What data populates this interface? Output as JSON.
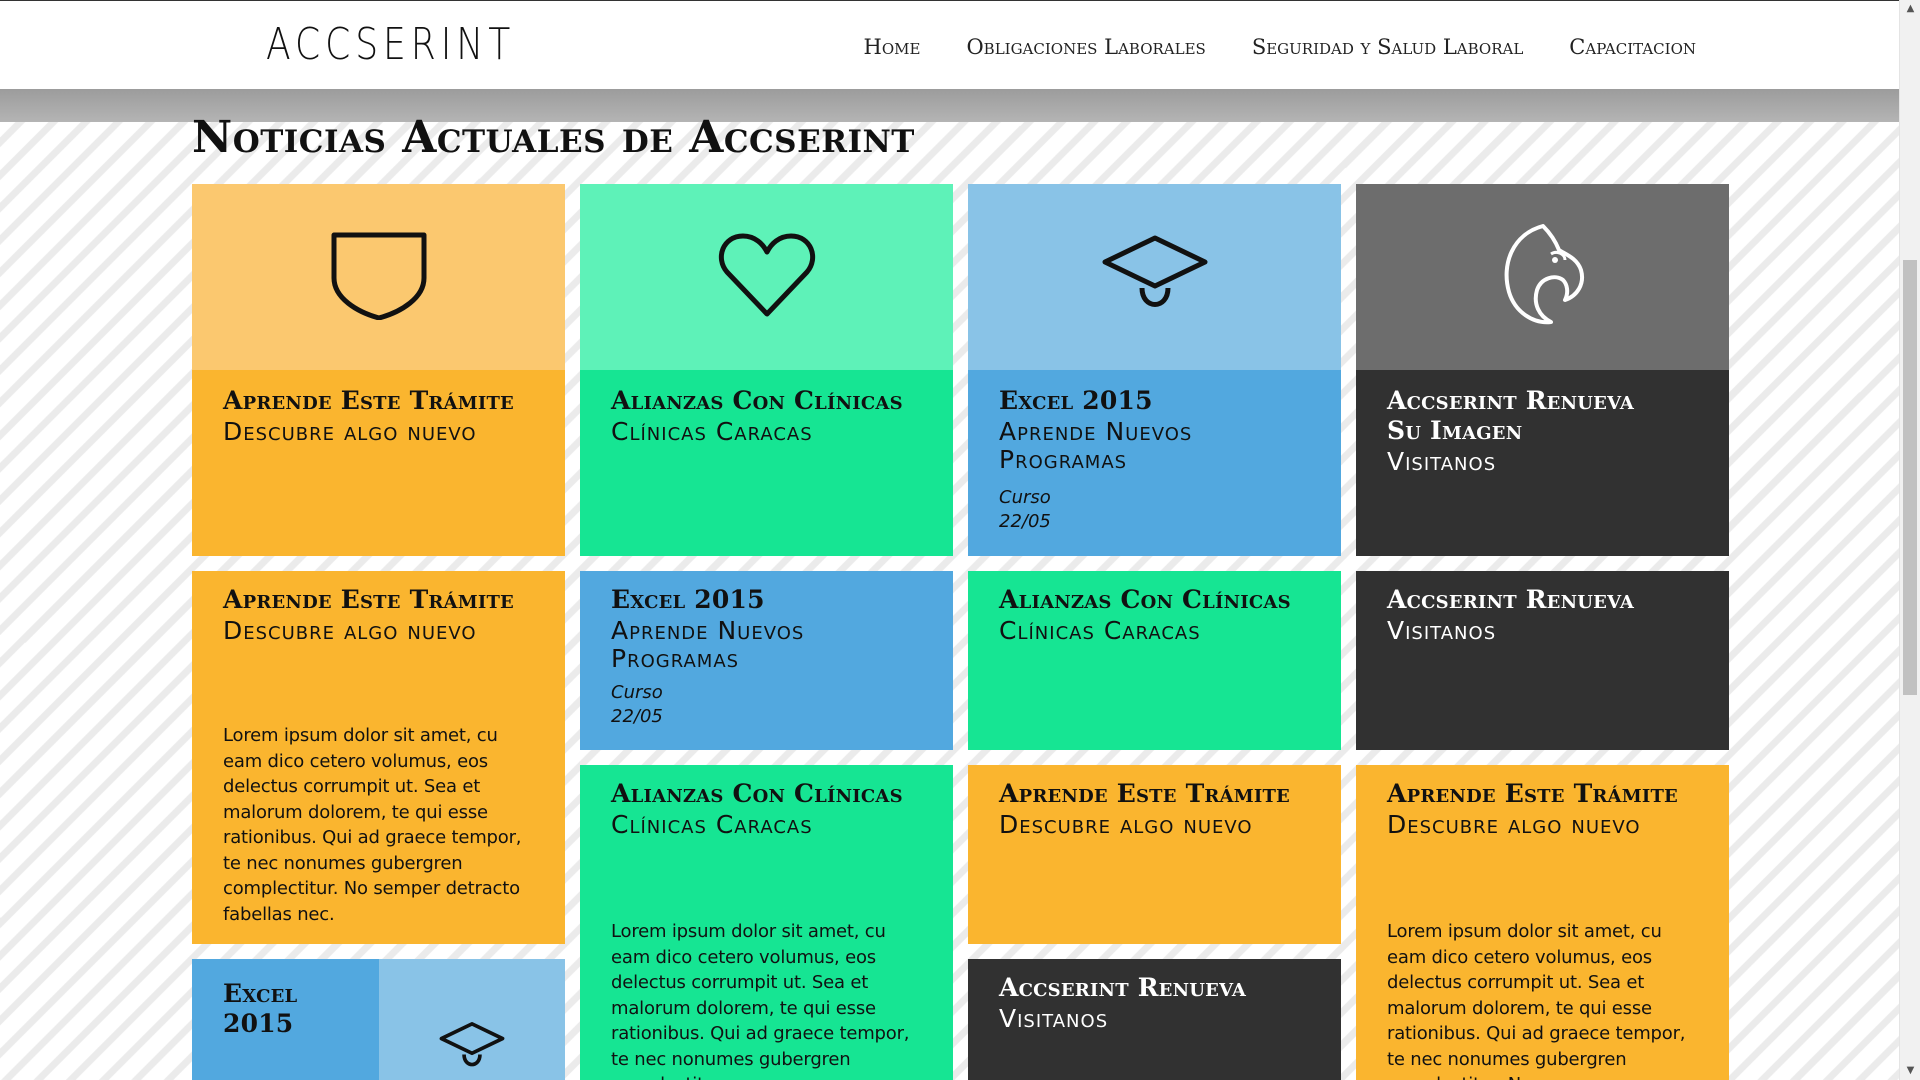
{
  "header": {
    "logo": "ACCSERINT",
    "nav": [
      "Home",
      "Obligaciones Laborales",
      "Seguridad y Salud Laboral",
      "Capacitacion"
    ]
  },
  "main": {
    "title": "Noticias Actuales de Accserint"
  },
  "colors": {
    "orange": "#fab52f",
    "orange_light": "#fbc86f",
    "green": "#16e593",
    "green_light": "#5ef2b8",
    "blue": "#52a8df",
    "blue_light": "#89c3e7",
    "dark": "#313131",
    "gray": "#6d6d6d"
  },
  "tiles": [
    {
      "title": "Aprende Este Trámite",
      "subtitle": "Descubre algo nuevo",
      "icon": "shield-icon"
    },
    {
      "title": "Alianzas Con Clínicas",
      "subtitle": "Clínicas Caracas",
      "icon": "heart-icon"
    },
    {
      "title": "Excel 2015",
      "subtitle": "Aprende Nuevos Programas",
      "meta_label": "Curso",
      "meta_date": "22/05",
      "icon": "graduation-cap-icon"
    },
    {
      "title": "Accserint Renueva Su Imagen",
      "subtitle": "Visitanos",
      "icon": "eagle-icon"
    },
    {
      "title": "Aprende Este Trámite",
      "subtitle": "Descubre algo nuevo",
      "body": "Lorem ipsum dolor sit amet, cu eam dico cetero volumus, eos delectus corrumpit ut. Sea et malorum dolorem, te qui esse rationibus. Qui ad graece tempor, te nec nonumes gubergren complectitur. No semper detracto fabellas nec."
    },
    {
      "title": "Excel 2015",
      "subtitle": "Aprende Nuevos Programas",
      "meta_label": "Curso",
      "meta_date": "22/05"
    },
    {
      "title": "Alianzas Con Clínicas",
      "subtitle": "Clínicas Caracas"
    },
    {
      "title": "Accserint Renueva",
      "subtitle": "Visitanos"
    },
    {
      "title": "Alianzas Con Clínicas",
      "subtitle": "Clínicas Caracas",
      "body": "Lorem ipsum dolor sit amet, cu eam dico cetero volumus, eos delectus corrumpit ut. Sea et malorum dolorem, te qui esse rationibus. Qui ad graece tempor, te nec nonumes gubergren complectitur."
    },
    {
      "title": "Aprende Este Trámite",
      "subtitle": "Descubre algo nuevo"
    },
    {
      "title": "Aprende Este Trámite",
      "subtitle": "Descubre algo nuevo",
      "body": "Lorem ipsum dolor sit amet, cu eam dico cetero volumus, eos delectus corrumpit ut. Sea et malorum dolorem, te qui esse rationibus. Qui ad graece tempor, te nec nonumes gubergren complectitur. No semper"
    },
    {
      "title": "Accserint Renueva",
      "subtitle": "Visitanos"
    },
    {
      "title": "Excel 2015",
      "icon": "graduation-cap-icon"
    }
  ]
}
